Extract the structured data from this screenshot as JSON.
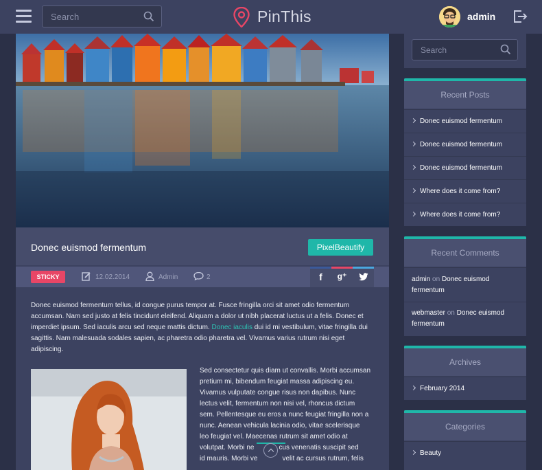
{
  "header": {
    "search_placeholder": "Search",
    "logo_text": "PinThis",
    "user_name": "admin"
  },
  "post": {
    "title": "Donec euismod fermentum",
    "tag_label": "PixelBeautify",
    "sticky_label": "STICKY",
    "date": "12.02.2014",
    "author": "Admin",
    "comments_count": "2",
    "share_icons": [
      "facebook-icon",
      "google-plus-icon",
      "twitter-icon"
    ],
    "intro": "Donec euismod fermentum tellus, id congue purus tempor at. Fusce fringilla orci sit amet odio fermentum accumsan. Nam sed justo at felis tincidunt eleifend. Aliquam a dolor ut nibh placerat luctus ut a felis. Donec et imperdiet ipsum. Sed iaculis arcu sed neque mattis dictum.",
    "intro_link": "Donec iaculis",
    "intro_end": "dui id mi vestibulum, vitae fringilla dui sagittis. Nam malesuada sodales sapien, ac pharetra odio pharetra vel. Vivamus varius rutrum nisi eget adipiscing.",
    "body_line_1": "Sed consectetur quis diam ut convallis. Morbi accumsan",
    "body_line_2": "pretium mi, bibendum feugiat massa adipiscing eu.",
    "body_line_3": "Vivamus vulputate congue risus non dapibus. Nunc",
    "body_line_4": "lectus velit, fermentum non nisi vel, rhoncus dictum",
    "body_line_5": "sem. Pellentesque eu eros a nunc feugiat fringilla non a",
    "body_line_6": "nunc. Aenean vehicula lacinia odio, vitae scelerisque",
    "body_line_7": "leo feugiat vel. Maecenas rutrum sit amet odio at",
    "body_line_8": "volutpat. Morbi ne",
    "body_line_8b": "cus venenatis suscipit sed",
    "body_line_9": "id mauris. Morbi ve",
    "body_line_9b": "velit ac cursus rutrum, felis"
  },
  "sidebar": {
    "search_placeholder": "Search",
    "recent_posts": {
      "title": "Recent Posts",
      "items": [
        "Donec euismod fermentum",
        "Donec euismod fermentum",
        "Donec euismod fermentum",
        "Where does it come from?",
        "Where does it come from?"
      ]
    },
    "recent_comments": {
      "title": "Recent Comments",
      "on_word": "on",
      "items": [
        {
          "author": "admin",
          "post_line_1": "Donec euismod",
          "post_line_2": "fermentum"
        },
        {
          "author": "webmaster",
          "post_line_1": "Donec euismod",
          "post_line_2": "fermentum"
        }
      ]
    },
    "archives": {
      "title": "Archives",
      "items": [
        "February 2014"
      ]
    },
    "categories": {
      "title": "Categories",
      "items": [
        "Beauty"
      ]
    }
  },
  "colors": {
    "background": "#2b3047",
    "panel": "#3c4260",
    "accent_teal": "#1fb7a9",
    "sticky_red": "#e84666",
    "logo_pin": "#e84666"
  }
}
